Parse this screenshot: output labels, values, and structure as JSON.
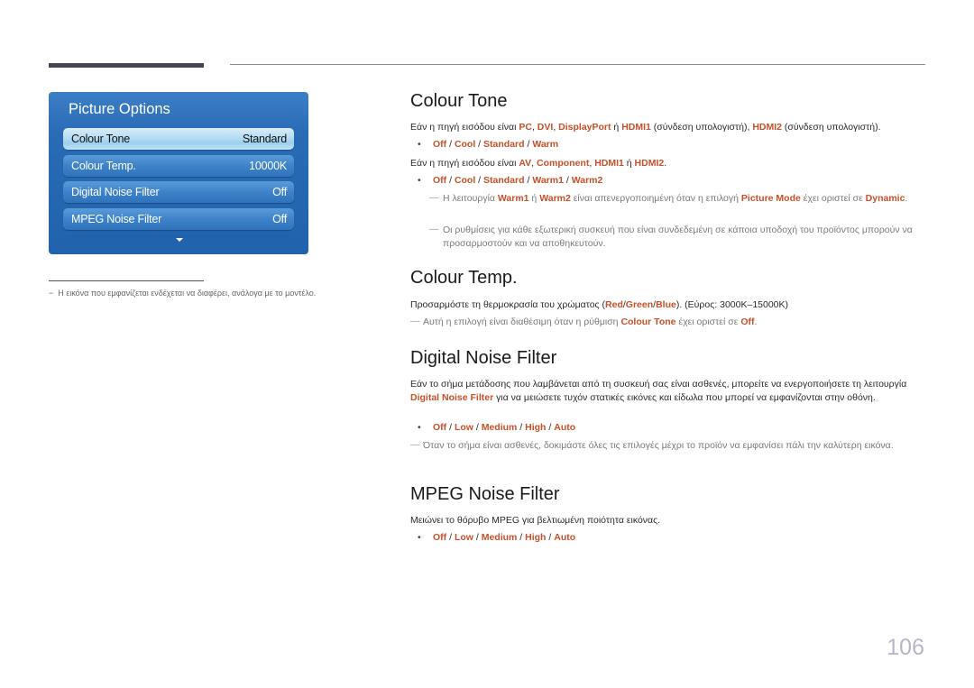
{
  "osd": {
    "title": "Picture Options",
    "items": [
      {
        "label": "Colour Tone",
        "value": "Standard",
        "selected": true
      },
      {
        "label": "Colour Temp.",
        "value": "10000K",
        "selected": false
      },
      {
        "label": "Digital Noise Filter",
        "value": "Off",
        "selected": false
      },
      {
        "label": "MPEG Noise Filter",
        "value": "Off",
        "selected": false
      }
    ]
  },
  "footnote": "Η εικόνα που εμφανίζεται ενδέχεται να διαφέρει, ανάλογα με το μοντέλο.",
  "colour_tone": {
    "heading": "Colour Tone",
    "p1": {
      "pre": "Εάν η πηγή εισόδου είναι ",
      "pc": "PC",
      "sep1": ", ",
      "dvi": "DVI",
      "sep2": ", ",
      "dp": "DisplayPort",
      "or": " ή ",
      "hdmi1": "HDMI1",
      "mid": " (σύνδεση υπολογιστή), ",
      "hdmi2": "HDMI2",
      "post": " (σύνδεση υπολογιστή)."
    },
    "opts1": [
      "Off",
      "Cool",
      "Standard",
      "Warm"
    ],
    "p2": {
      "pre": "Εάν η πηγή εισόδου είναι ",
      "av": "AV",
      "sep1": ", ",
      "comp": "Component",
      "sep2": ", ",
      "hdmi1": "HDMI1",
      "or": " ή ",
      "hdmi2": "HDMI2",
      "post": "."
    },
    "opts2": [
      "Off",
      "Cool",
      "Standard",
      "Warm1",
      "Warm2"
    ],
    "note1": {
      "pre": "Η λειτουργία ",
      "w1": "Warm1",
      "or": " ή ",
      "w2": "Warm2",
      "mid": " είναι απενεργοποιημένη όταν η επιλογή ",
      "pm": "Picture Mode",
      "mid2": " έχει οριστεί σε ",
      "dyn": "Dynamic",
      "post": "."
    },
    "note2": "Οι ρυθμίσεις για κάθε εξωτερική συσκευή που είναι συνδεδεμένη σε κάποια υποδοχή του προϊόντος μπορούν να προσαρμοστούν και να αποθηκευτούν."
  },
  "colour_temp": {
    "heading": "Colour Temp.",
    "p1": {
      "pre": "Προσαρμόστε τη θερμοκρασία του χρώματος (",
      "red": "Red",
      "s1": "/",
      "green": "Green",
      "s2": "/",
      "blue": "Blue",
      "post": "). (Εύρος: 3000K–15000K)"
    },
    "note": {
      "pre": "Αυτή η επιλογή είναι διαθέσιμη όταν η ρύθμιση ",
      "ct": "Colour Tone",
      "mid": " έχει οριστεί σε ",
      "off": "Off",
      "post": "."
    }
  },
  "dnf": {
    "heading": "Digital Noise Filter",
    "p1": {
      "pre": "Εάν το σήμα μετάδοσης που λαμβάνεται από τη συσκευή σας είναι ασθενές, μπορείτε να ενεργοποιήσετε τη λειτουργία ",
      "dnf": "Digital Noise Filter",
      "post": " για να μειώσετε τυχόν στατικές εικόνες και είδωλα που μπορεί να εμφανίζονται στην οθόνη."
    },
    "opts": [
      "Off",
      "Low",
      "Medium",
      "High",
      "Auto"
    ],
    "note": "Όταν το σήμα είναι ασθενές, δοκιμάστε όλες τις επιλογές μέχρι το προϊόν να εμφανίσει πάλι την καλύτερη εικόνα."
  },
  "mpeg": {
    "heading": "MPEG Noise Filter",
    "p1": "Μειώνει το θόρυβο MPEG για βελτιωμένη ποιότητα εικόνας.",
    "opts": [
      "Off",
      "Low",
      "Medium",
      "High",
      "Auto"
    ]
  },
  "page_number": "106",
  "colors": {
    "accent": "#c8502a",
    "osd_blue": "#2162ad"
  }
}
